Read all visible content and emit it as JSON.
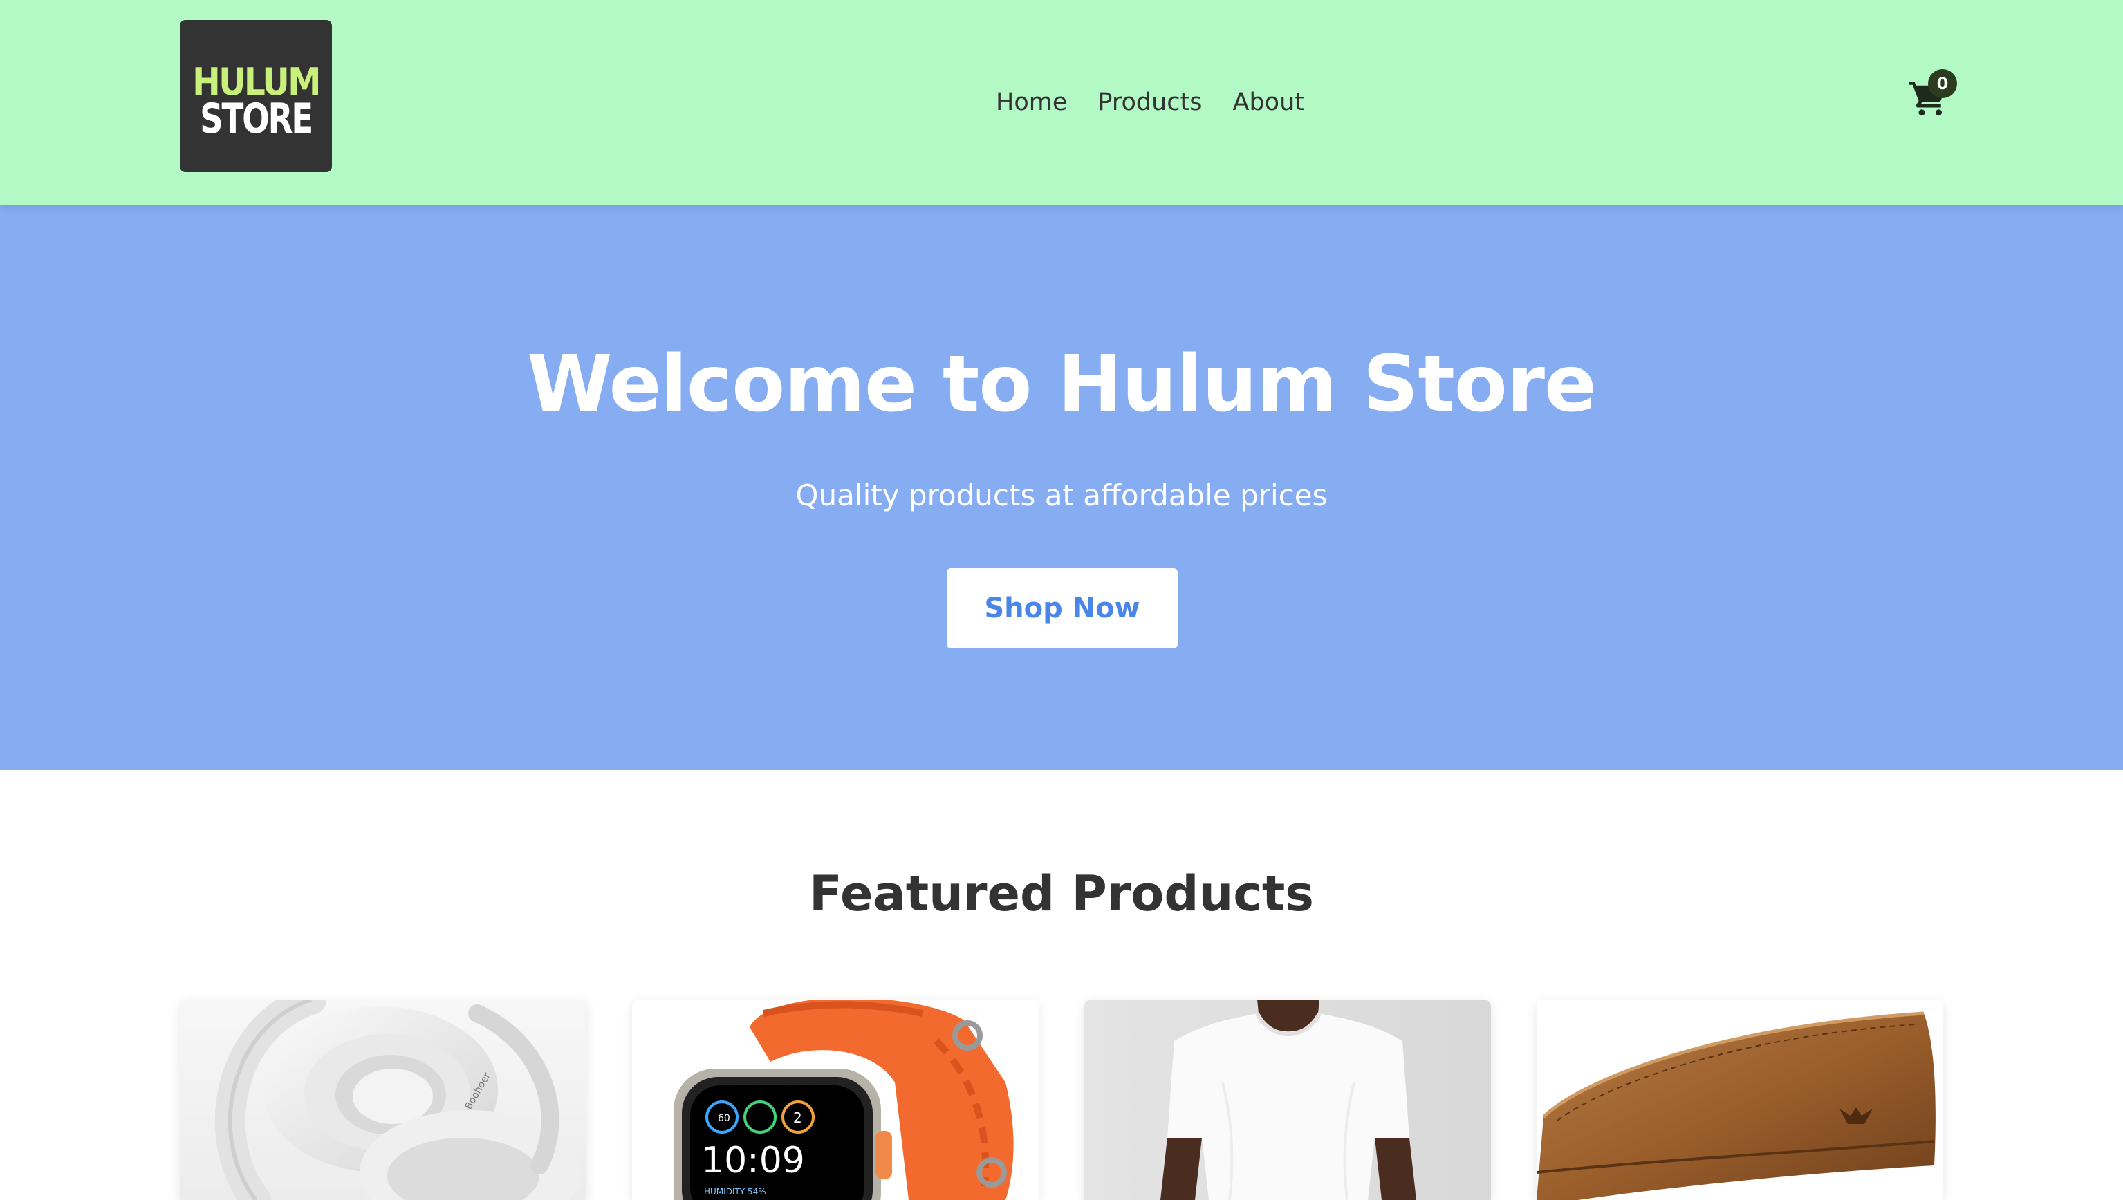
{
  "header": {
    "logo": {
      "line1": "HULUM",
      "line2": "STORE",
      "background": "#333333",
      "accent": "#c8f07a"
    },
    "nav": [
      {
        "label": "Home"
      },
      {
        "label": "Products"
      },
      {
        "label": "About"
      }
    ],
    "cart": {
      "icon": "shopping-cart-icon",
      "count": "0"
    },
    "background": "#b3f9c6"
  },
  "hero": {
    "title": "Welcome to Hulum Store",
    "subtitle": "Quality products at affordable prices",
    "cta_label": "Shop Now",
    "background": "#86acf1",
    "cta_text_color": "#4a86e8"
  },
  "featured": {
    "title": "Featured Products",
    "products": [
      {
        "image": "white-headphones-image"
      },
      {
        "image": "smartwatch-orange-band-image",
        "watch_time": "10:09",
        "watch_label": "HUMIDITY 54%"
      },
      {
        "image": "white-tshirt-image"
      },
      {
        "image": "brown-leather-wallet-image"
      }
    ]
  }
}
